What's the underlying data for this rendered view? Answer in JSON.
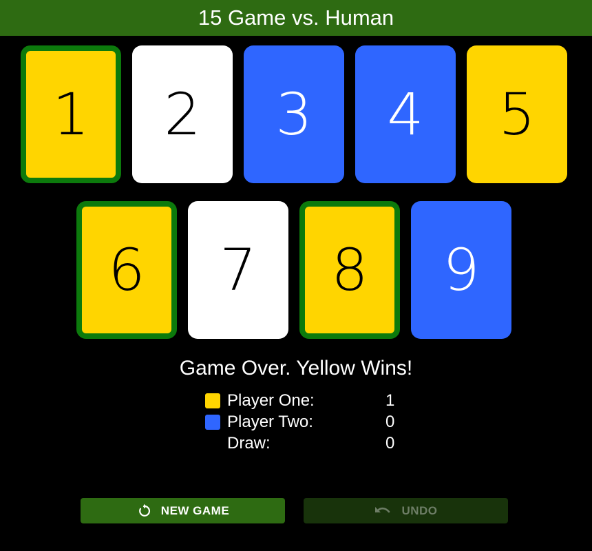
{
  "header": {
    "title": "15 Game vs. Human"
  },
  "colors": {
    "header_bg": "#2e6b12",
    "yellow": "#ffd500",
    "blue": "#2f66ff",
    "white": "#ffffff",
    "win_border": "#0c7a0c"
  },
  "cards": [
    {
      "number": "1",
      "owner": "yellow",
      "winning": true
    },
    {
      "number": "2",
      "owner": "none",
      "winning": false
    },
    {
      "number": "3",
      "owner": "blue",
      "winning": false
    },
    {
      "number": "4",
      "owner": "blue",
      "winning": false
    },
    {
      "number": "5",
      "owner": "yellow",
      "winning": false
    },
    {
      "number": "6",
      "owner": "yellow",
      "winning": true
    },
    {
      "number": "7",
      "owner": "none",
      "winning": false
    },
    {
      "number": "8",
      "owner": "yellow",
      "winning": true
    },
    {
      "number": "9",
      "owner": "blue",
      "winning": false
    }
  ],
  "status": "Game Over. Yellow Wins!",
  "scoreboard": {
    "player_one": {
      "label": "Player One:",
      "value": "1",
      "color": "#ffd500"
    },
    "player_two": {
      "label": "Player Two:",
      "value": "0",
      "color": "#2f66ff"
    },
    "draw": {
      "label": "Draw:",
      "value": "0"
    }
  },
  "buttons": {
    "new_game": {
      "label": "NEW GAME",
      "icon": "restart-icon",
      "enabled": true
    },
    "undo": {
      "label": "UNDO",
      "icon": "undo-icon",
      "enabled": false
    }
  }
}
